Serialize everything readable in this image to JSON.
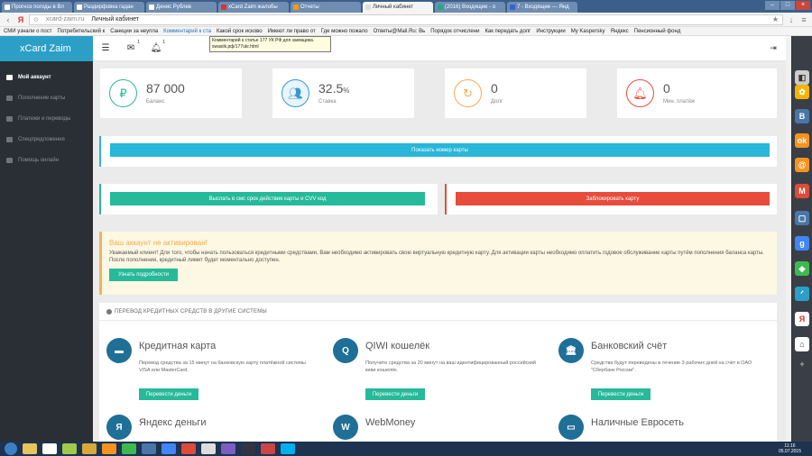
{
  "browser": {
    "tabs": [
      {
        "label": "Прогноз погоды в Вл"
      },
      {
        "label": "Раздирфовка гадан"
      },
      {
        "label": "Денис Рублев"
      },
      {
        "label": "xCard Zaim жалобы"
      },
      {
        "label": "Отчеты"
      },
      {
        "label": "Личный кабинет",
        "active": true
      },
      {
        "label": "(2016) Входящие - о"
      },
      {
        "label": "7 - Входящие — Янд"
      }
    ],
    "url_domain": "xcard-zaim.ru",
    "url_title": "Личный кабинет",
    "bookmarks": [
      "СМИ узнали о пост",
      "Потребительский к",
      "Санкции за неупла",
      "Комментарий к ста",
      "Какой срок исково",
      "Имеют ли право от",
      "Где можно пожало",
      "Ответы@Mail.Ru: Вь",
      "Порядок отчислени",
      "Как передать долг",
      "Инструкции",
      "My Kaspersky",
      "Яндекс",
      "Пенсионный фонд"
    ],
    "tooltip": "Комментарий к статье 177 УК РФ для заемщика. swasiik.рф/177ukr.html"
  },
  "sidebar": {
    "logo": "xCard Zaim",
    "items": [
      {
        "label": "Мой аккаунт",
        "active": true
      },
      {
        "label": "Пополнение карты"
      },
      {
        "label": "Платежи и переводы"
      },
      {
        "label": "Спецпредложения"
      },
      {
        "label": "Помощь онлайн"
      }
    ]
  },
  "topbar": {
    "mail_badge": "1",
    "bell_badge": "1"
  },
  "stats": [
    {
      "value": "87 000",
      "unit": "",
      "label": "Баланс",
      "icon": "ruble-icon",
      "color": "#26b99a",
      "glyph": "₽"
    },
    {
      "value": "32.5",
      "unit": "%",
      "label": "Ставка",
      "icon": "users-icon",
      "color": "#3498db",
      "glyph": "👥"
    },
    {
      "value": "0",
      "unit": "",
      "label": "Долг",
      "icon": "refresh-icon",
      "color": "#f0ad4e",
      "glyph": "↻"
    },
    {
      "value": "0",
      "unit": "",
      "label": "Мин. платёж",
      "icon": "bell-icon",
      "color": "#e74c3c",
      "glyph": "🔔"
    }
  ],
  "actions": {
    "show_card_number": "Показать номер карты",
    "send_sms": "Выслать в смс срок действия карты и CVV код",
    "block_card": "Заблокировать карту"
  },
  "colors": {
    "info": "#29b6d8",
    "success": "#26b99a",
    "danger": "#e74c3c",
    "warning": "#f0ad4e",
    "sidebar": "#2a2f36",
    "brand": "#2c9fc7"
  },
  "notice": {
    "title": "Ваш аккаунт не активирован!",
    "text": "Уважаемый клиент! Для того, чтобы начать пользоваться кредитными средствами, Вам необходимо активировать свою виртуальную кредитную карту. Для активации карты необходимо оплатить годовое обслуживание карты путём пополнения баланса карты. После пополнения, кредитный лимит будет моментально доступен.",
    "button": "Узнать подробности"
  },
  "transfer": {
    "heading": "ПЕРЕВОД КРЕДИТНЫХ СРЕДСТВ В ДРУГИЕ СИСТЕМЫ",
    "methods": [
      {
        "name": "Кредитная карта",
        "glyph": "▬",
        "desc": "Перевод средства за 15 минут на банковскую карту платёжной системы VISA или MasterCard.",
        "button": "Перевести деньги"
      },
      {
        "name": "QIWI кошелёк",
        "glyph": "Q",
        "desc": "Получите средства за 20 минут на ваш идентифицированный российский киви кошелёк.",
        "button": "Перевести деньги"
      },
      {
        "name": "Банковский счёт",
        "glyph": "🏛",
        "desc": "Средства будут переведены в течение 3 рабочих дней на счёт в ОАО \"Сбербанк России\".",
        "button": "Перевести деньги"
      },
      {
        "name": "Яндекс деньги",
        "glyph": "Я"
      },
      {
        "name": "WebMoney",
        "glyph": "W"
      },
      {
        "name": "Наличные Евросеть",
        "glyph": "▭"
      }
    ]
  },
  "taskbar": {
    "time": "11:16",
    "date": "05.07.2015"
  }
}
